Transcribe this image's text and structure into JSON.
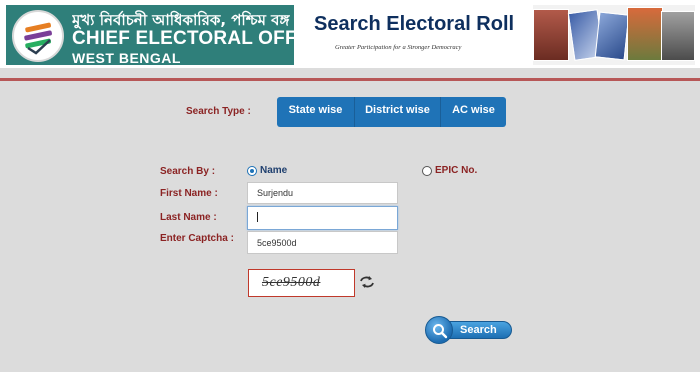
{
  "header": {
    "org_title_bengali": "মুখ্য নির্বাচনী আধিকারিক, পশ্চিম বঙ্গ",
    "org_title_line1": "CHIEF ELECTORAL OFFICER,",
    "org_title_line2": "WEST BENGAL",
    "page_title": "Search Electoral Roll",
    "tagline": "Greater Participation for a Stronger Democracy"
  },
  "search_type": {
    "label": "Search Type :",
    "tabs": [
      "State wise",
      "District wise",
      "AC wise"
    ]
  },
  "form": {
    "search_by_label": "Search By :",
    "options": [
      {
        "label": "Name",
        "checked": true
      },
      {
        "label": "EPIC No.",
        "checked": false
      }
    ],
    "first_name_label": "First Name :",
    "first_name_value": "Surjendu",
    "last_name_label": "Last Name :",
    "last_name_value": "",
    "captcha_label": "Enter Captcha :",
    "captcha_value": "5ce9500d"
  },
  "captcha": {
    "image_text": "5ce9500d",
    "refresh_icon": "refresh-icon"
  },
  "search_button": {
    "label": "Search",
    "icon": "search-icon"
  },
  "colors": {
    "header_bg": "#2f7f7a",
    "accent_blue": "#1f73b7",
    "label_red": "#8b2323",
    "divider": "#b75757",
    "page_bg": "#dcdcdc"
  }
}
